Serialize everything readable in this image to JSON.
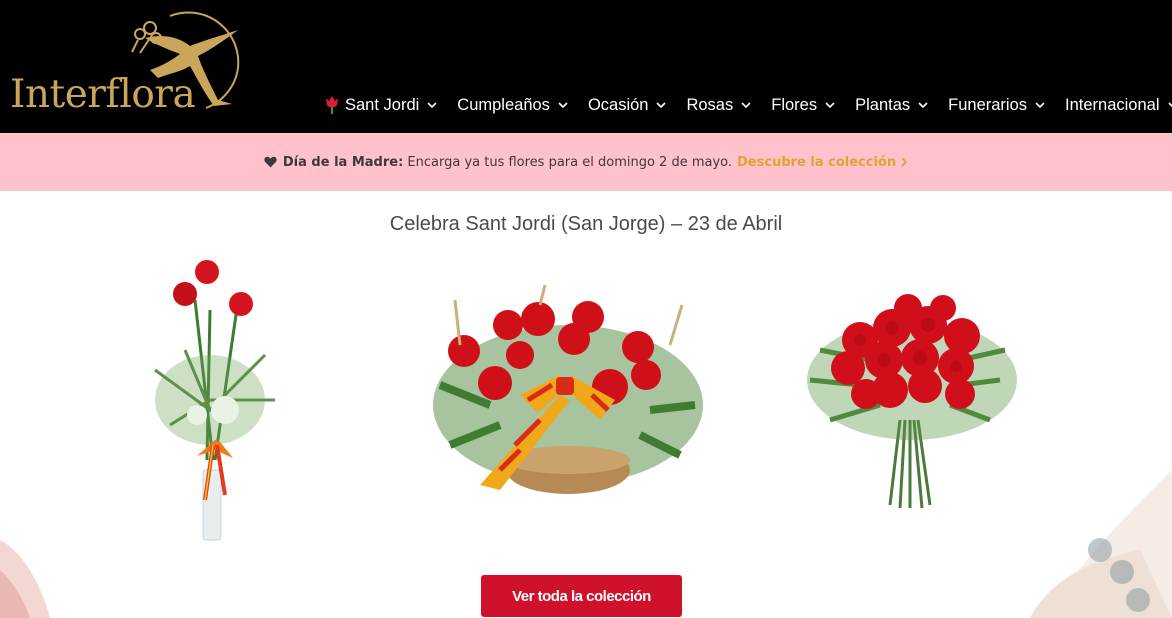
{
  "brand": {
    "name": "Interflora",
    "gold": "#c9a65a"
  },
  "nav": {
    "items": [
      {
        "label": "Sant Jordi",
        "icon": "tulip-icon"
      },
      {
        "label": "Cumpleaños"
      },
      {
        "label": "Ocasión"
      },
      {
        "label": "Rosas"
      },
      {
        "label": "Flores"
      },
      {
        "label": "Plantas"
      },
      {
        "label": "Funerarios"
      },
      {
        "label": "Internacional"
      }
    ]
  },
  "promo": {
    "icon": "heart-icon",
    "label": "Día de la Madre:",
    "text": "Encarga ya tus flores para el domingo 2 de mayo.",
    "link": "Descubre la colección",
    "background": "#ffc2cd",
    "link_color": "#e0a234"
  },
  "main": {
    "title": "Celebra Sant Jordi (San Jorge) – 23 de Abril",
    "products": [
      {
        "image": "three-roses-vase"
      },
      {
        "image": "rose-basket-senyera-ribbon"
      },
      {
        "image": "red-rose-bouquet"
      }
    ],
    "cta": {
      "label": "Ver toda la colección",
      "color": "#d0112b"
    }
  }
}
